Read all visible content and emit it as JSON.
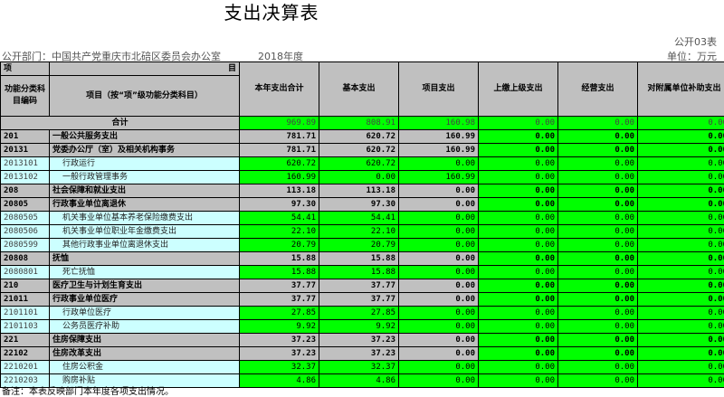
{
  "title": "支出决算表",
  "code_label": "公开03表",
  "unit_label": "单位：万元",
  "department": "公开部门：中国共产党重庆市北碚区委员会办公室",
  "year": "2018年度",
  "header": {
    "xiang": "项",
    "mu": "目",
    "code_col": "功能分类科目编码",
    "name_col": "项目（按“项”级功能分类科目）",
    "cols": [
      "本年支出合计",
      "基本支出",
      "项目支出",
      "上缴上级支出",
      "经营支出",
      "对附属单位补助支出"
    ]
  },
  "total_row": {
    "label": "合计",
    "values": [
      "969.89",
      "808.91",
      "160.98",
      "0.00",
      "0.00",
      "0.00"
    ]
  },
  "rows": [
    {
      "code": "201",
      "name": "一般公共服务支出",
      "level": 1,
      "values": [
        "781.71",
        "620.72",
        "160.99",
        "0.00",
        "0.00",
        "0.00"
      ]
    },
    {
      "code": "20131",
      "name": "党委办公厅（室）及相关机构事务",
      "level": 1,
      "values": [
        "781.71",
        "620.72",
        "160.99",
        "0.00",
        "0.00",
        "0.00"
      ]
    },
    {
      "code": "2013101",
      "name": "行政运行",
      "level": 2,
      "values": [
        "620.72",
        "620.72",
        "0.00",
        "0.00",
        "0.00",
        "0.00"
      ]
    },
    {
      "code": "2013102",
      "name": "一般行政管理事务",
      "level": 2,
      "values": [
        "160.99",
        "0.00",
        "160.99",
        "0.00",
        "0.00",
        "0.00"
      ]
    },
    {
      "code": "208",
      "name": "社会保障和就业支出",
      "level": 1,
      "values": [
        "113.18",
        "113.18",
        "0.00",
        "0.00",
        "0.00",
        "0.00"
      ]
    },
    {
      "code": "20805",
      "name": "行政事业单位离退休",
      "level": 1,
      "values": [
        "97.30",
        "97.30",
        "0.00",
        "0.00",
        "0.00",
        "0.00"
      ]
    },
    {
      "code": "2080505",
      "name": "机关事业单位基本养老保险缴费支出",
      "level": 2,
      "values": [
        "54.41",
        "54.41",
        "0.00",
        "0.00",
        "0.00",
        "0.00"
      ]
    },
    {
      "code": "2080506",
      "name": "机关事业单位职业年金缴费支出",
      "level": 2,
      "values": [
        "22.10",
        "22.10",
        "0.00",
        "0.00",
        "0.00",
        "0.00"
      ]
    },
    {
      "code": "2080599",
      "name": "其他行政事业单位离退休支出",
      "level": 2,
      "values": [
        "20.79",
        "20.79",
        "0.00",
        "0.00",
        "0.00",
        "0.00"
      ]
    },
    {
      "code": "20808",
      "name": "抚恤",
      "level": 1,
      "values": [
        "15.88",
        "15.88",
        "0.00",
        "0.00",
        "0.00",
        "0.00"
      ]
    },
    {
      "code": "2080801",
      "name": "死亡抚恤",
      "level": 2,
      "values": [
        "15.88",
        "15.88",
        "0.00",
        "0.00",
        "0.00",
        "0.00"
      ]
    },
    {
      "code": "210",
      "name": "医疗卫生与计划生育支出",
      "level": 1,
      "values": [
        "37.77",
        "37.77",
        "0.00",
        "0.00",
        "0.00",
        "0.00"
      ]
    },
    {
      "code": "21011",
      "name": "行政事业单位医疗",
      "level": 1,
      "values": [
        "37.77",
        "37.77",
        "0.00",
        "0.00",
        "0.00",
        "0.00"
      ]
    },
    {
      "code": "2101101",
      "name": "行政单位医疗",
      "level": 2,
      "values": [
        "27.85",
        "27.85",
        "0.00",
        "0.00",
        "0.00",
        "0.00"
      ]
    },
    {
      "code": "2101103",
      "name": "公务员医疗补助",
      "level": 2,
      "values": [
        "9.92",
        "9.92",
        "0.00",
        "0.00",
        "0.00",
        "0.00"
      ]
    },
    {
      "code": "221",
      "name": "住房保障支出",
      "level": 1,
      "values": [
        "37.23",
        "37.23",
        "0.00",
        "0.00",
        "0.00",
        "0.00"
      ]
    },
    {
      "code": "22102",
      "name": "住房改革支出",
      "level": 1,
      "values": [
        "37.23",
        "37.23",
        "0.00",
        "0.00",
        "0.00",
        "0.00"
      ]
    },
    {
      "code": "2210201",
      "name": "住房公积金",
      "level": 2,
      "values": [
        "32.37",
        "32.37",
        "0.00",
        "0.00",
        "0.00",
        "0.00"
      ]
    },
    {
      "code": "2210203",
      "name": "购房补贴",
      "level": 2,
      "values": [
        "4.86",
        "4.86",
        "0.00",
        "0.00",
        "0.00",
        "0.00"
      ]
    }
  ],
  "note": "备注：本表反映部门本年度各项支出情况。",
  "colors": {
    "header_gray": "#c0c0c0",
    "value_green": "#00ff00",
    "sub_cyan": "#ccffff"
  }
}
